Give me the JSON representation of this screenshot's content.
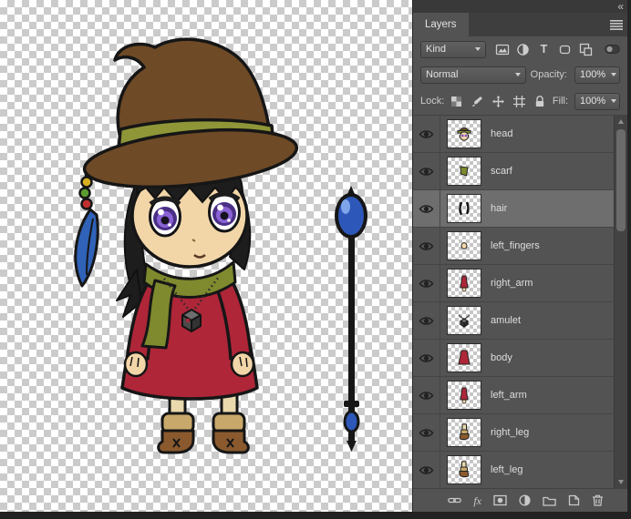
{
  "titlebar": {
    "collapse_glyph": "«"
  },
  "panel": {
    "tab_label": "Layers",
    "filter_row": {
      "kind_value": "Kind",
      "type_glyph": "T",
      "icons": [
        "pixel-layer-filter-icon",
        "adjustment-layer-filter-icon",
        "type-layer-filter-icon",
        "shape-layer-filter-icon",
        "smart-object-filter-icon",
        "filter-toggle-icon"
      ]
    },
    "blend_row": {
      "mode_value": "Normal",
      "opacity_label": "Opacity:",
      "opacity_value": "100%"
    },
    "lock_row": {
      "label": "Lock:",
      "icons": [
        "lock-transparent-pixels-icon",
        "lock-image-pixels-icon",
        "lock-position-icon",
        "lock-artboard-icon",
        "lock-all-icon"
      ],
      "fill_label": "Fill:",
      "fill_value": "100%"
    },
    "layers": [
      {
        "name": "head",
        "visible": true,
        "selected": false
      },
      {
        "name": "scarf",
        "visible": true,
        "selected": false
      },
      {
        "name": "hair",
        "visible": true,
        "selected": true
      },
      {
        "name": "left_fingers",
        "visible": true,
        "selected": false
      },
      {
        "name": "right_arm",
        "visible": true,
        "selected": false
      },
      {
        "name": "amulet",
        "visible": true,
        "selected": false
      },
      {
        "name": "body",
        "visible": true,
        "selected": false
      },
      {
        "name": "left_arm",
        "visible": true,
        "selected": false
      },
      {
        "name": "right_leg",
        "visible": true,
        "selected": false
      },
      {
        "name": "left_leg",
        "visible": true,
        "selected": false
      }
    ],
    "bottom_bar": {
      "fx_label": "fx",
      "icons": [
        "link-layers-icon",
        "layer-style-icon",
        "add-layer-mask-icon",
        "adjustment-layer-icon",
        "new-group-icon",
        "new-layer-icon",
        "delete-layer-icon"
      ]
    }
  },
  "canvas_colors": {
    "checker_light": "#ffffff",
    "checker_dark": "#cbcbcb",
    "hat": "#6e4a26",
    "hat_band": "#8f9638",
    "hair": "#1d1d1d",
    "skin": "#f2d6a8",
    "eye_iris": "#8a63d6",
    "dress": "#ae2638",
    "scarf": "#7e8a2d",
    "boots": "#8a5a2e",
    "staff_orb": "#2d57b8"
  },
  "ui_colors": {
    "panel_bg": "#535353",
    "panel_header": "#3e3e3e",
    "selected_row": "#6e6e6e",
    "text": "#d8d8d8"
  }
}
